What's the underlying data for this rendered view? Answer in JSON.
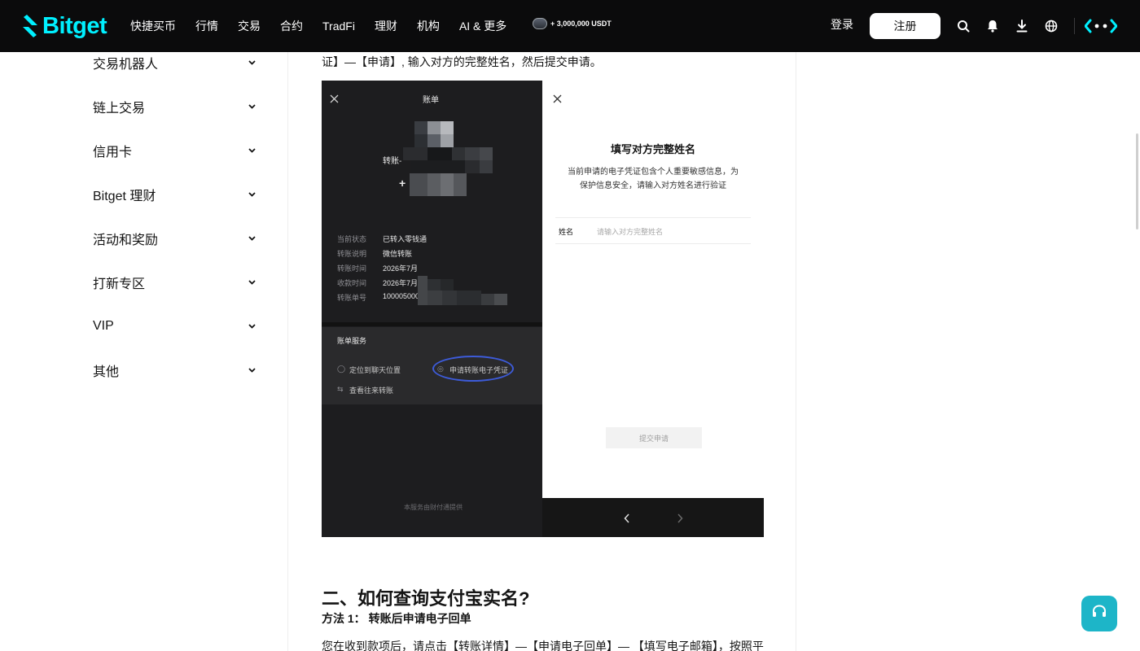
{
  "header": {
    "logo_text": "Bitget",
    "nav": [
      "快捷买币",
      "行情",
      "交易",
      "合约",
      "TradFi",
      "理财",
      "机构",
      "AI & 更多"
    ],
    "promo": "+ 3,000,000 USDT",
    "login": "登录",
    "signup": "注册",
    "icons": [
      "search-icon",
      "bell-icon",
      "download-icon",
      "globe-icon",
      "ai-agent-icon"
    ],
    "accent": "#00f0ff"
  },
  "sidebar": {
    "items": [
      "交易机器人",
      "链上交易",
      "信用卡",
      "Bitget 理财",
      "活动和奖励",
      "打新专区",
      "VIP",
      "其他"
    ]
  },
  "article": {
    "intro_line": "证】—【申请】, 输入对方的完整姓名，然后提交申请。",
    "screenshot": {
      "left": {
        "title": "账单",
        "transfer_prefix": "转账-",
        "fields": [
          {
            "label": "当前状态",
            "value": "已转入零钱通"
          },
          {
            "label": "转账说明",
            "value": "微信转账"
          },
          {
            "label": "转账时间",
            "value": "2026年7月"
          },
          {
            "label": "收款时间",
            "value": "2026年7月"
          },
          {
            "label": "转账单号",
            "value": "100005000"
          }
        ],
        "services_title": "账单服务",
        "service_locate": "定位到聊天位置",
        "service_apply": "申请转账电子凭证",
        "service_history": "查看往来转账",
        "footer": "本服务由财付通提供"
      },
      "right": {
        "title": "填写对方完整姓名",
        "desc_line1": "当前申请的电子凭证包含个人重要敏感信息，为",
        "desc_line2": "保护信息安全，请输入对方姓名进行验证",
        "name_label": "姓名",
        "name_placeholder": "请输入对方完整姓名",
        "submit": "提交申请"
      }
    },
    "section_title": "二、如何查询支付宝实名?",
    "method_title": "方法 1： 转账后申请电子回单",
    "body_line": "您在收到款项后，请点击【转账详情】—【申请电子回单】— 【填写电子邮箱】，按照平"
  }
}
